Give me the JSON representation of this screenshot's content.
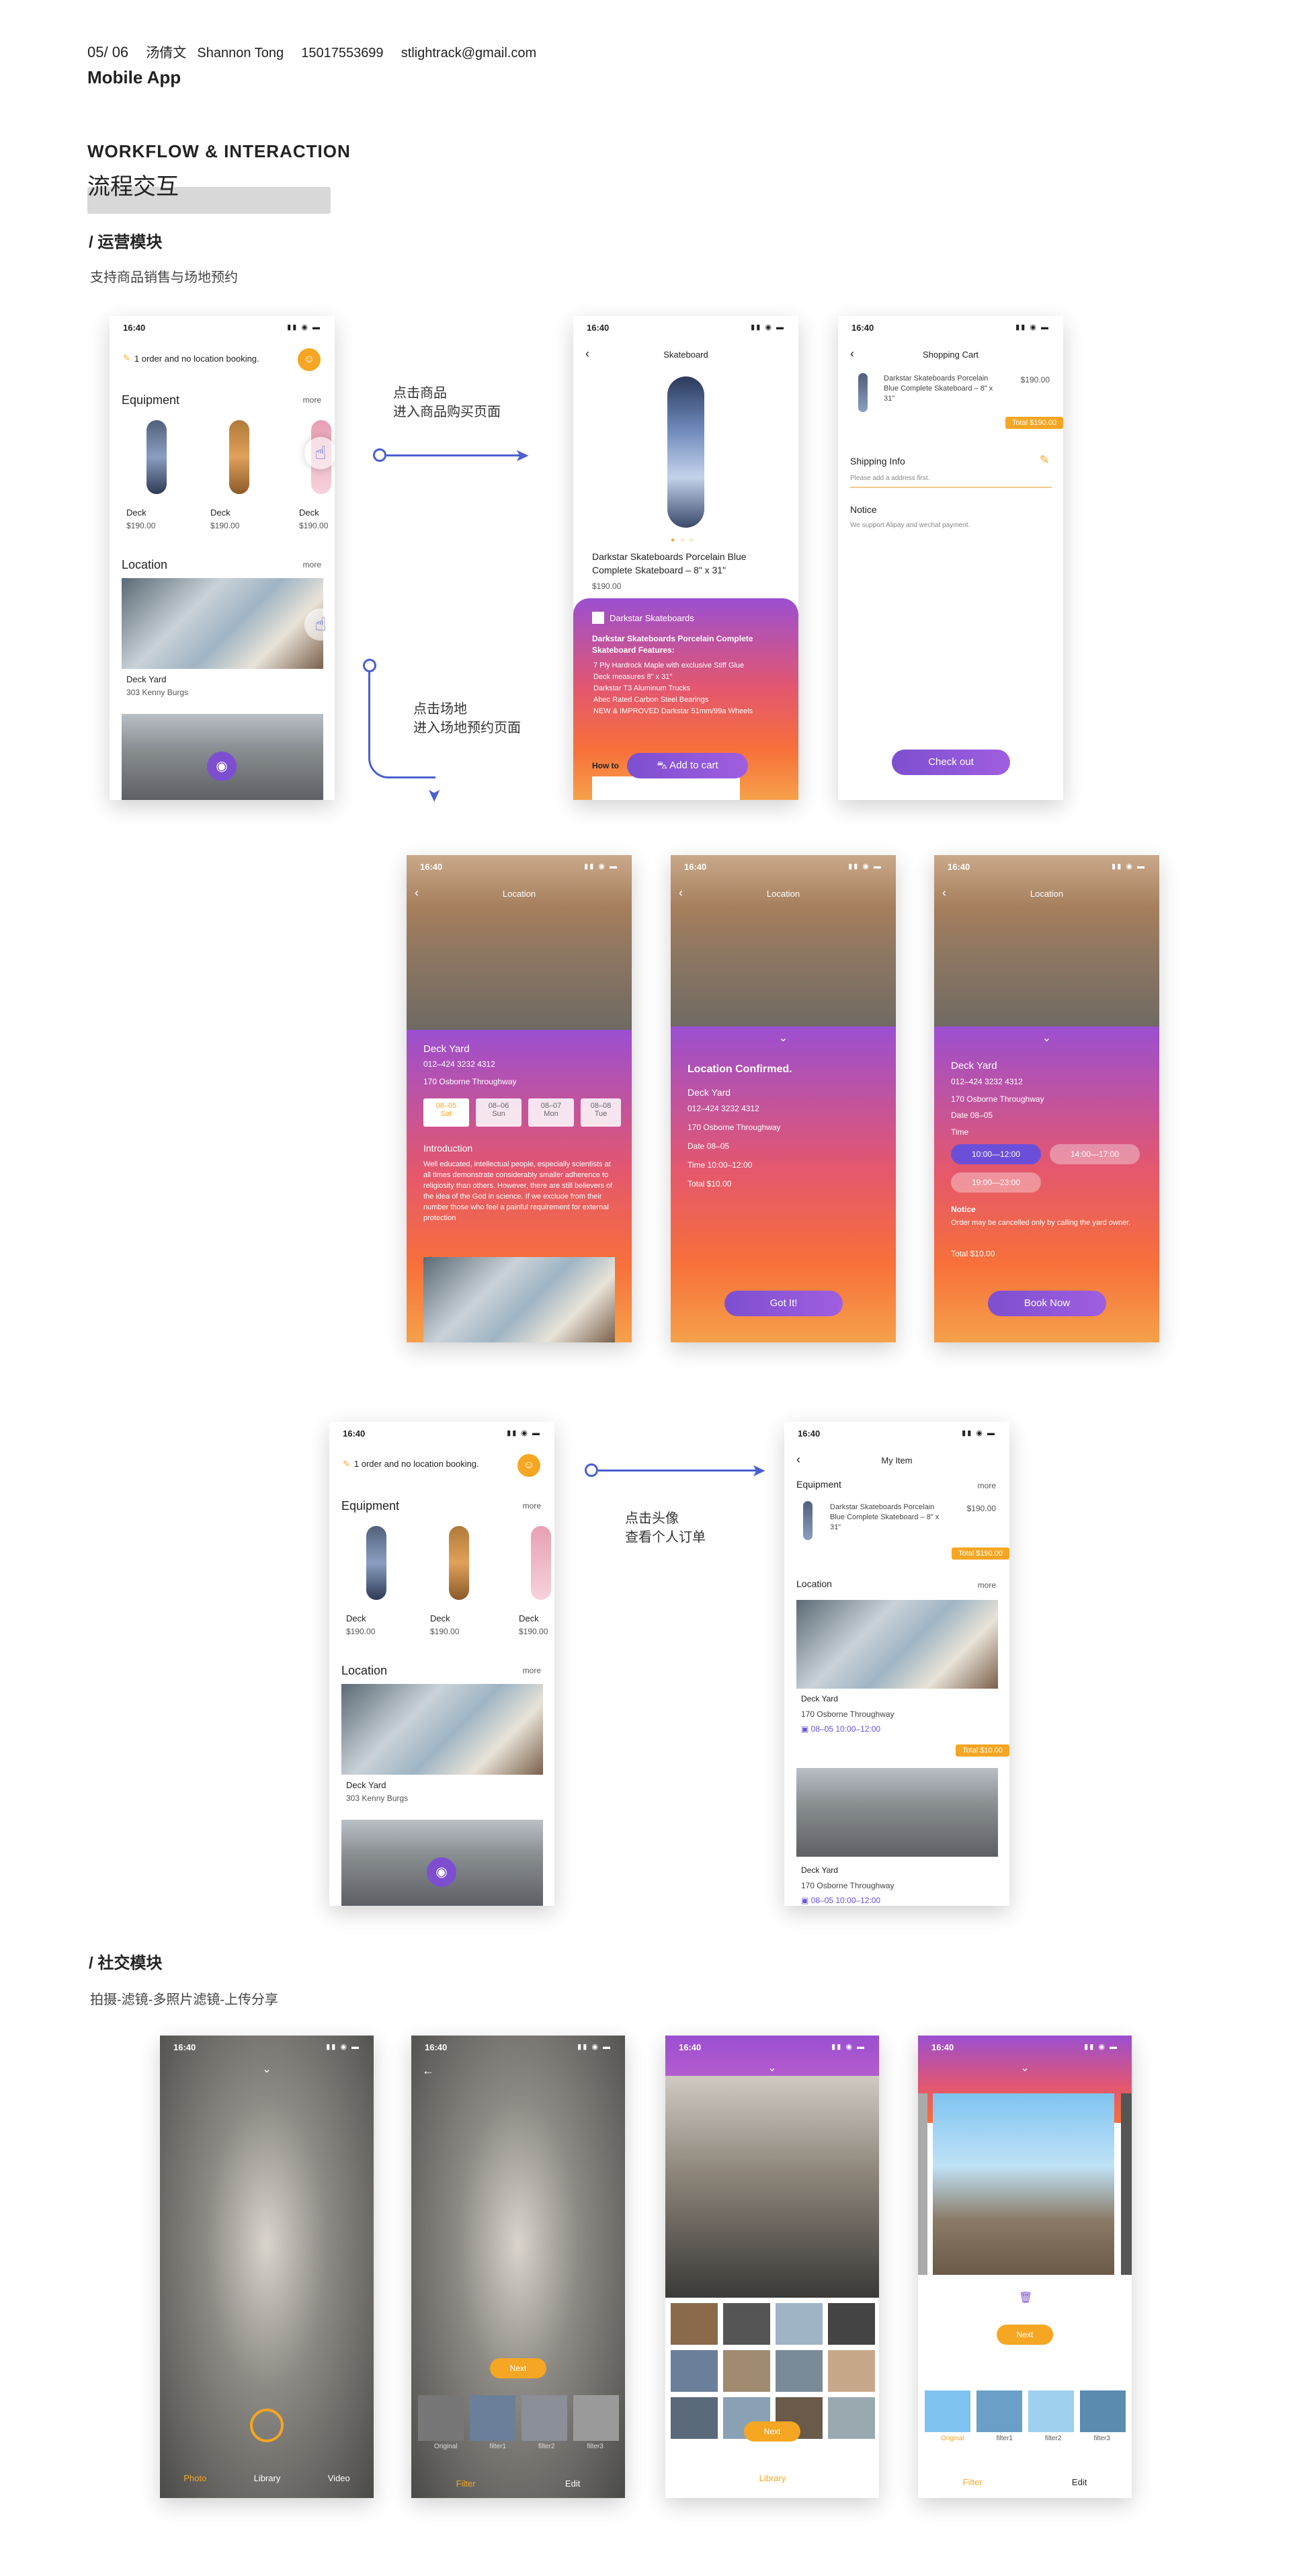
{
  "header": {
    "page_no": "05/ 06",
    "name_cn": "汤倩文",
    "name_en": "Shannon Tong",
    "phone": "15017553699",
    "email": "stlightrack@gmail.com",
    "project": "Mobile App"
  },
  "section": {
    "title_en": "WORKFLOW & INTERACTION",
    "title_cn": "流程交互"
  },
  "ops": {
    "title": "/ 运营模块",
    "subtitle": "支持商品销售与场地预约",
    "note1_l1": "点击商品",
    "note1_l2": "进入商品购买页面",
    "note2_l1": "点击场地",
    "note2_l2": "进入场地预约页面",
    "note3_l1": "点击头像",
    "note3_l2": "查看个人订单"
  },
  "social": {
    "title": "/ 社交模块",
    "subtitle": "拍摄-滤镜-多照片滤镜-上传分享"
  },
  "status": {
    "time": "16:40"
  },
  "home": {
    "banner": "1 order and no location booking.",
    "equipment": "Equipment",
    "more": "more",
    "products": [
      {
        "name": "Deck",
        "price": "$190.00"
      },
      {
        "name": "Deck",
        "price": "$190.00"
      },
      {
        "name": "Deck",
        "price": "$190.00"
      }
    ],
    "location": "Location",
    "loc_name": "Deck Yard",
    "loc_addr": "303 Kenny Burgs"
  },
  "product": {
    "title": "Skateboard",
    "name": "Darkstar Skateboards Porcelain Blue Complete Skateboard – 8\" x 31\"",
    "price": "$190.00",
    "brand": "Darkstar Skateboards",
    "feat_title": "Darkstar Skateboards Porcelain Complete Skateboard Features:",
    "features": [
      "7 Ply Hardrock Maple with exclusive Stiff Glue",
      "Deck measures 8\" x 31\"",
      "Darkstar T3 Aluminum Trucks",
      "Abec Rated Carbon Steel Bearings",
      "NEW & IMPROVED Darkstar 51mm/99a Wheels"
    ],
    "howto": "How to",
    "add_to_cart": "Add to cart"
  },
  "cart": {
    "title": "Shopping Cart",
    "item": "Darkstar Skateboards Porcelain Blue Complete Skateboard – 8\" x 31\"",
    "price": "$190.00",
    "total": "Total  $190.00",
    "ship_title": "Shipping Info",
    "ship_hint": "Please add a address first.",
    "notice_title": "Notice",
    "notice_text": "We support Alipay and wechat payment.",
    "checkout": "Check out"
  },
  "loc1": {
    "title": "Location",
    "name": "Deck Yard",
    "phone": "012–424 3232 4312",
    "addr": "170 Osborne Throughway",
    "dates": [
      {
        "d": "08–05",
        "w": "Sat"
      },
      {
        "d": "08–06",
        "w": "Sun"
      },
      {
        "d": "08–07",
        "w": "Mon"
      },
      {
        "d": "08–08",
        "w": "Tue"
      }
    ],
    "intro_title": "Introduction",
    "intro": "Well educated, intellectual people, especially scientists at all times demonstrate considerably smaller adherence to religiosity than others. However, there are still believers of the idea of the God in science. If we exclude from their number those who feel a painful requirement for external protection"
  },
  "loc2": {
    "title": "Location",
    "confirmed": "Location Confirmed.",
    "name": "Deck Yard",
    "phone": "012–424 3232 4312",
    "addr": "170 Osborne Throughway",
    "date": "Date   08–05",
    "time": "Time   10:00–12:00",
    "total": "Total   $10.00",
    "button": "Got It!"
  },
  "loc3": {
    "title": "Location",
    "name": "Deck Yard",
    "phone": "012–424 3232 4312",
    "addr": "170 Osborne Throughway",
    "date": "Date   08–05",
    "time_label": "Time",
    "slots": [
      "10:00—12:00",
      "14:00—17:00",
      "19:00—23:00"
    ],
    "notice_title": "Notice",
    "notice": "Order may be cancelled only by calling the yard owner.",
    "total": "Total   $10.00",
    "button": "Book Now"
  },
  "myitem": {
    "title": "My Item",
    "equipment": "Equipment",
    "more": "more",
    "item": "Darkstar Skateboards Porcelain Blue Complete Skateboard – 8\" x 31\"",
    "price": "$190.00",
    "total1": "Total  $190.00",
    "location": "Location",
    "loc_name": "Deck Yard",
    "loc_addr": "170 Osborne Throughway",
    "loc_time": "08–05  10:00–12:00",
    "total2": "Total  $10.00",
    "loc_name2": "Deck Yard",
    "loc_addr2": "170 Osborne Throughway",
    "loc_time2": "08–05  10:00–12:00"
  },
  "cam": {
    "tabs": [
      "Photo",
      "Library",
      "Video"
    ],
    "next": "Next",
    "filters": [
      "Original",
      "filter1",
      "filter2",
      "filter3"
    ],
    "tabs2": [
      "Filter",
      "Edit"
    ]
  },
  "colors": {
    "accent": "#f5a623",
    "purple": "#7d4fd0",
    "arrow": "#4a5fd0"
  }
}
